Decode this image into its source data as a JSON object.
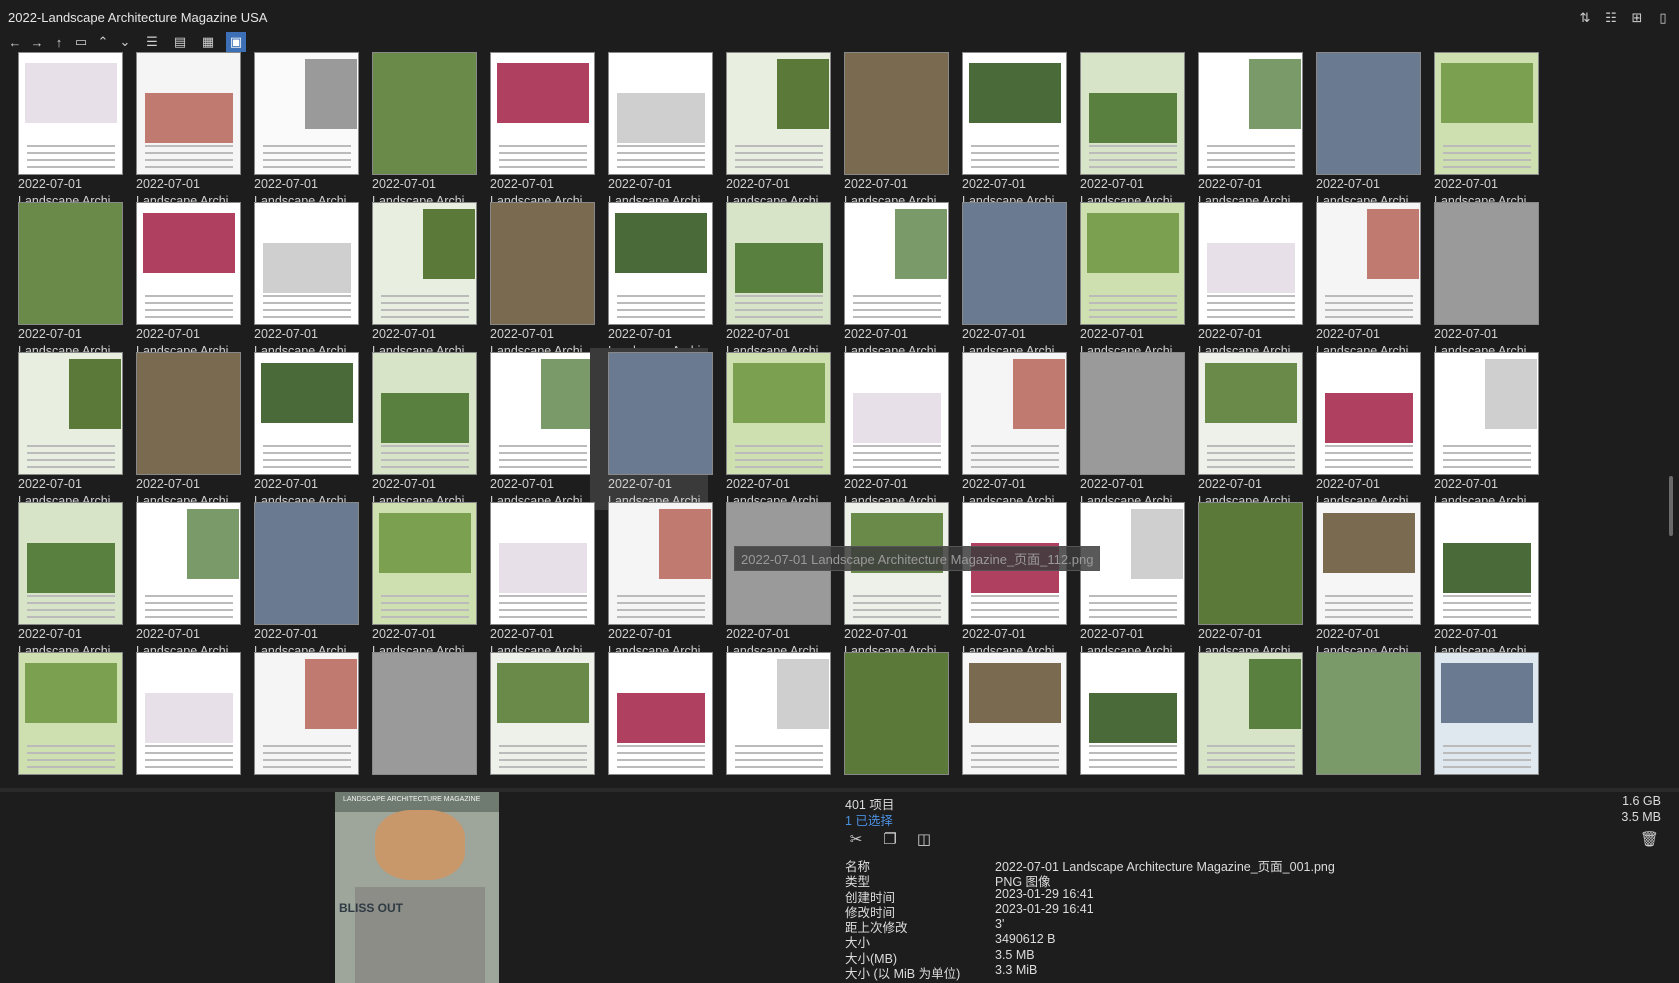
{
  "window": {
    "title": "2022-Landscape Architecture Magazine USA",
    "tools": [
      "sort-icon",
      "details-icon",
      "add-pane-icon",
      "clipboard-icon"
    ]
  },
  "toolbar": {
    "nav": [
      {
        "name": "back-icon",
        "glyph": "←"
      },
      {
        "name": "forward-icon",
        "glyph": "→"
      },
      {
        "name": "up-icon",
        "glyph": "↑"
      },
      {
        "name": "folder-icon",
        "glyph": "▭"
      },
      {
        "name": "chevron-up-icon",
        "glyph": "⌃"
      },
      {
        "name": "chevron-down-icon",
        "glyph": "⌄"
      }
    ],
    "views": [
      {
        "name": "list-view-icon",
        "glyph": "☰",
        "active": false
      },
      {
        "name": "details-view-icon",
        "glyph": "▤",
        "active": false
      },
      {
        "name": "tiles-view-icon",
        "glyph": "▦",
        "active": false
      },
      {
        "name": "thumbnail-view-icon",
        "glyph": "▣",
        "active": true
      }
    ]
  },
  "grid": {
    "item_date": "2022-07-01",
    "item_name": "Landscape Archi...",
    "rows": 5,
    "cols": 13,
    "selected_index": 31,
    "captioned_rows": 4
  },
  "tooltip": "2022-07-01 Landscape Architecture Magazine_页面_112.png",
  "status": {
    "item_count": "401 项目",
    "selected_count": "1 已选择",
    "total_size": "1.6 GB",
    "selected_size": "3.5 MB"
  },
  "preview": {
    "masthead": "LANDSCAPE ARCHITECTURE MAGAZINE",
    "headline": "BLISS OUT"
  },
  "properties": [
    {
      "key": "名称",
      "value": "2022-07-01 Landscape Architecture Magazine_页面_001.png"
    },
    {
      "key": "类型",
      "value": "PNG 图像"
    },
    {
      "key": "创建时间",
      "value": "2023-01-29  16:41"
    },
    {
      "key": "修改时间",
      "value": "2023-01-29  16:41"
    },
    {
      "key": "距上次修改",
      "value": "3'"
    },
    {
      "key": "大小",
      "value": "3490612 B"
    },
    {
      "key": "大小(MB)",
      "value": "3.5 MB"
    },
    {
      "key": "大小 (以 MiB 为单位)",
      "value": "3.3 MiB"
    }
  ],
  "colors": {
    "background": "#1d1d1d",
    "accent": "#3c6fb6",
    "selection_text": "#4a8fe0"
  }
}
